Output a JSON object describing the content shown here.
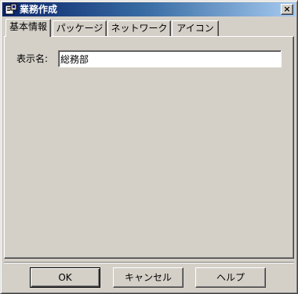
{
  "window": {
    "title": "業務作成",
    "close_glyph": "×",
    "icon": "app-icon"
  },
  "tabs": [
    {
      "label": "基本情報",
      "active": true
    },
    {
      "label": "パッケージ",
      "active": false
    },
    {
      "label": "ネットワーク",
      "active": false
    },
    {
      "label": "アイコン",
      "active": false
    }
  ],
  "form": {
    "display_name_label": "表示名:",
    "display_name_value": "総務部"
  },
  "buttons": {
    "ok_label": "OK",
    "cancel_label": "キャンセル",
    "help_label": "ヘルプ"
  },
  "colors": {
    "titlebar_start": "#0a246a",
    "titlebar_end": "#a6caf0",
    "face": "#d4d0c8"
  }
}
